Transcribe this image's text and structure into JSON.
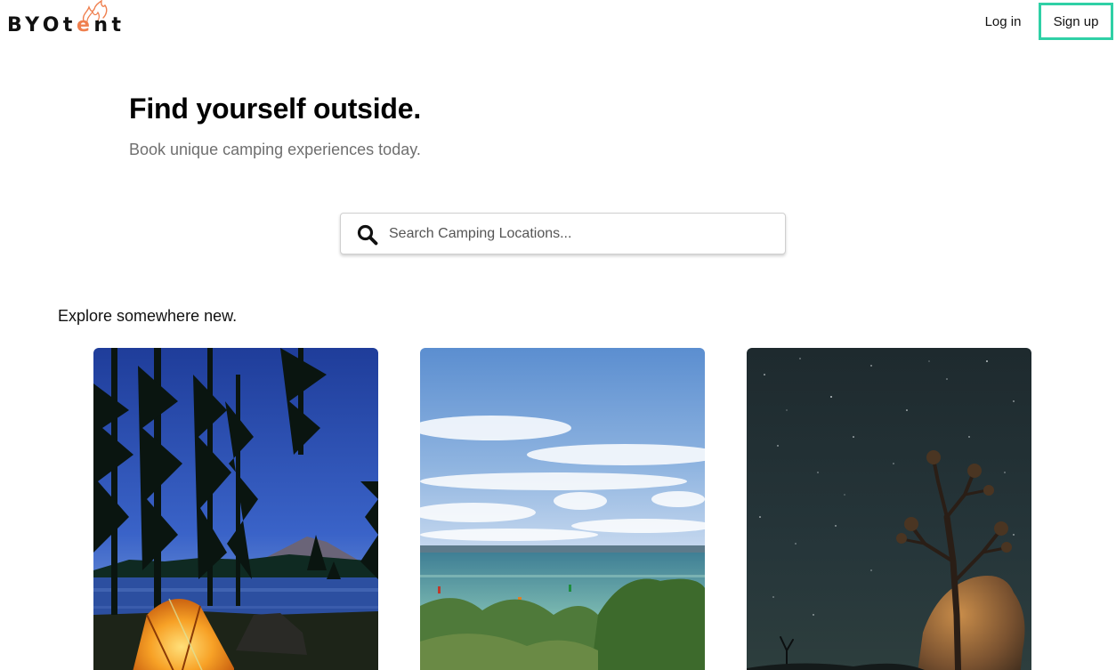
{
  "header": {
    "logo": {
      "prefix": "BYOt",
      "accent": "e",
      "suffix": "nt",
      "accent_color": "#ef7f4e"
    },
    "login_label": "Log in",
    "signup_label": "Sign up",
    "signup_border_color": "#2fd0a6"
  },
  "hero": {
    "title": "Find yourself outside.",
    "subtitle": "Book unique camping experiences today."
  },
  "search": {
    "icon": "search-icon",
    "placeholder": "Search Camping Locations...",
    "value": ""
  },
  "explore": {
    "heading": "Explore somewhere new.",
    "cards": [
      {
        "image": "tent-by-lake-at-dusk"
      },
      {
        "image": "lakeshore-with-clouds"
      },
      {
        "image": "joshua-tree-under-stars"
      }
    ]
  }
}
